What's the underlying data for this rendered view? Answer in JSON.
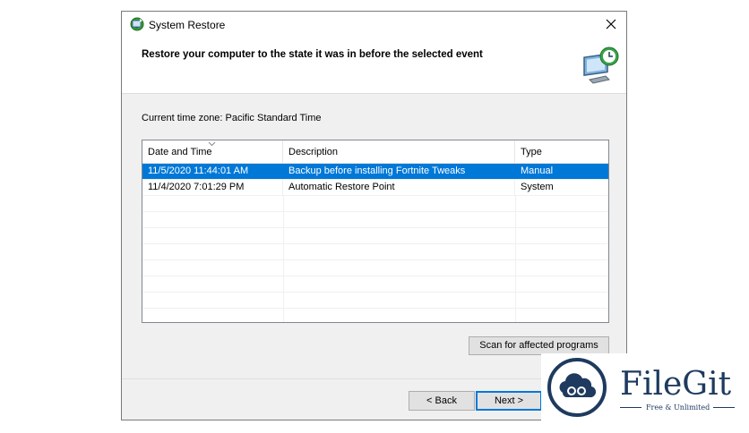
{
  "window": {
    "title": "System Restore",
    "header_title": "Restore your computer to the state it was in before the selected event",
    "title_icon": "system-restore-icon",
    "header_icon": "restore-monitor-clock-icon"
  },
  "timezone_label": "Current time zone: Pacific Standard Time",
  "table": {
    "columns": [
      "Date and Time",
      "Description",
      "Type"
    ],
    "rows": [
      {
        "date": "11/5/2020 11:44:01 AM",
        "description": "Backup before installing Fortnite Tweaks",
        "type": "Manual",
        "selected": true
      },
      {
        "date": "11/4/2020 7:01:29 PM",
        "description": "Automatic Restore Point",
        "type": "System",
        "selected": false
      }
    ]
  },
  "buttons": {
    "scan": "Scan for affected programs",
    "back": "< Back",
    "next": "Next >"
  },
  "watermark": {
    "name": "FileGit",
    "tagline": "Free & Unlimited"
  },
  "colors": {
    "selection": "#0078d7",
    "logo": "#1e3a5f"
  }
}
